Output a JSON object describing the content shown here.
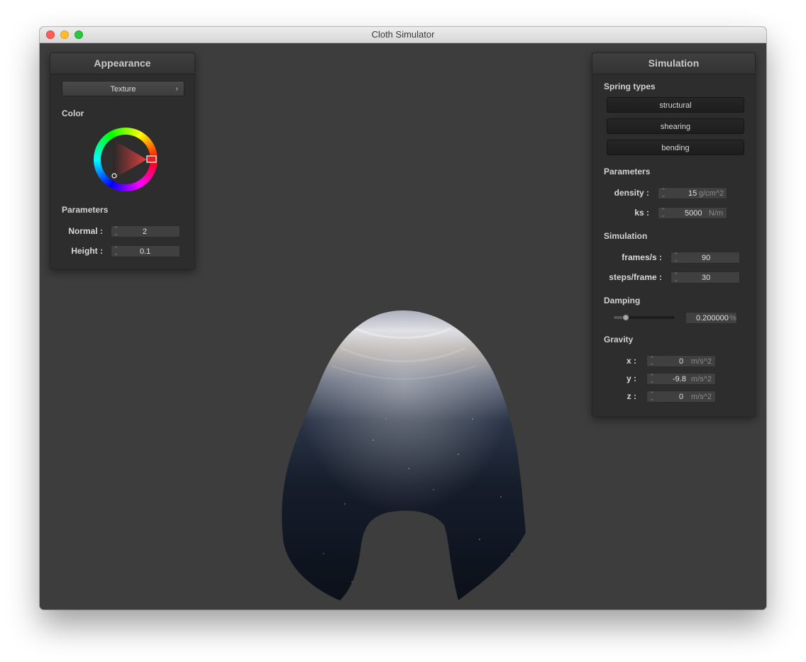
{
  "window": {
    "title": "Cloth Simulator"
  },
  "appearance": {
    "title": "Appearance",
    "shader_dropdown": "Texture",
    "color_label": "Color",
    "color_value": "#e02020",
    "parameters_label": "Parameters",
    "normal": {
      "label": "Normal :",
      "value": "2"
    },
    "height": {
      "label": "Height :",
      "value": "0.1"
    }
  },
  "simulation": {
    "title": "Simulation",
    "spring_types_label": "Spring types",
    "spring_buttons": [
      "structural",
      "shearing",
      "bending"
    ],
    "parameters_label": "Parameters",
    "density": {
      "label": "density :",
      "value": "15",
      "unit": "g/cm^2"
    },
    "ks": {
      "label": "ks :",
      "value": "5000",
      "unit": "N/m"
    },
    "simulation_label": "Simulation",
    "frames": {
      "label": "frames/s :",
      "value": "90"
    },
    "steps": {
      "label": "steps/frame :",
      "value": "30"
    },
    "damping_label": "Damping",
    "damping": {
      "value": "0.200000",
      "unit": "%",
      "slider_fraction": 0.2
    },
    "gravity_label": "Gravity",
    "gravity": {
      "x": {
        "label": "x :",
        "value": "0",
        "unit": "m/s^2"
      },
      "y": {
        "label": "y :",
        "value": "-9.8",
        "unit": "m/s^2"
      },
      "z": {
        "label": "z :",
        "value": "0",
        "unit": "m/s^2"
      }
    }
  }
}
